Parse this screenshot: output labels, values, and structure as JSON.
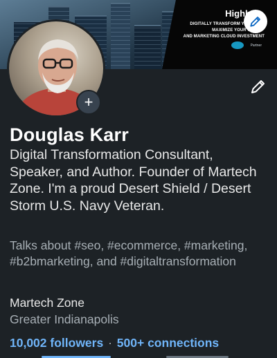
{
  "banner": {
    "brand": "Highb",
    "line1": "DIGITALLY TRANSFORM YOUR ORG",
    "line2": "MAXIMIZE YOUR SA",
    "line3": "AND MARKETING CLOUD INVESTMENT",
    "partner_label": "Partner"
  },
  "profile": {
    "name": "Douglas Karr",
    "headline": "Digital Transformation Consultant, Speaker, and Author. Founder of Martech Zone. I'm a proud Desert Shield / Desert Storm U.S. Navy Veteran.",
    "talks_about": "Talks about #seo, #ecommerce, #marketing, #b2bmarketing, and #digitaltransformation",
    "company": "Martech Zone",
    "location": "Greater Indianapolis",
    "followers": "10,002 followers",
    "separator": "·",
    "connections": "500+ connections"
  },
  "icons": {
    "add": "+",
    "edit_banner": "pencil-icon",
    "edit_profile": "pencil-icon"
  },
  "colors": {
    "background": "#1d2226",
    "link": "#70b5f9",
    "secondary_text": "#a8b0b6",
    "primary_text": "#e9e9e9"
  }
}
